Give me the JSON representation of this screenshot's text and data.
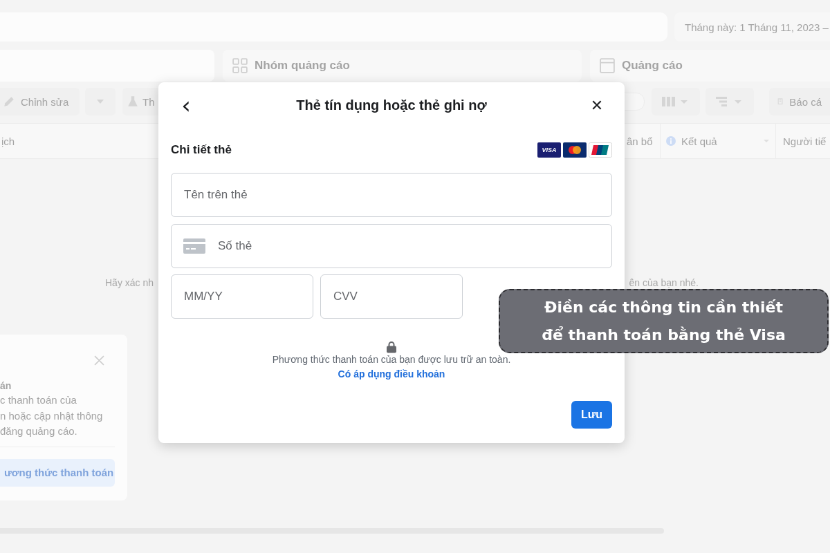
{
  "header": {
    "date_range": "Tháng này: 1 Tháng 11, 2023 –"
  },
  "level_tabs": [
    {
      "label": "Nhóm quảng cáo",
      "selected": false
    },
    {
      "label": "Quảng cáo",
      "selected": false
    }
  ],
  "toolbar": {
    "edit": "Chỉnh sửa",
    "test": "Th",
    "toggle": {
      "on": false
    },
    "reports": "Báo cá"
  },
  "table": {
    "columns": [
      "ịch",
      "ân bổ",
      "Kết quả",
      "Người tiế"
    ],
    "empty_message_parts": [
      "Hãy xác nh",
      "ên của bạn nhé."
    ]
  },
  "payment_card": {
    "title": "án",
    "body_lines": [
      "c thanh toán của",
      "n hoặc cập nhật thông",
      "đăng quảng cáo."
    ],
    "button": "ương thức thanh toán"
  },
  "dialog": {
    "back": "‹",
    "title": "Thẻ tín dụng hoặc thẻ ghi nợ",
    "close": "✕",
    "section": "Chi tiết thẻ",
    "card_brands": [
      {
        "kind": "visa",
        "label": "VISA"
      },
      {
        "kind": "mastercard"
      },
      {
        "kind": "unionpay"
      }
    ],
    "fields": [
      {
        "kind": "full",
        "placeholder": "Tên trên thẻ"
      },
      {
        "kind": "card",
        "placeholder": "Số thẻ"
      },
      {
        "kind": "half",
        "placeholder": "MM/YY"
      },
      {
        "kind": "half",
        "placeholder": "CVV"
      }
    ],
    "notice": "Phương thức thanh toán của bạn được lưu trữ an toàn.",
    "terms_link": "Có áp dụng điều khoản",
    "save": "Lưu"
  },
  "callout": {
    "lines": [
      "Điền các thông tin cần thiết",
      "để thanh toán bằng thẻ Visa"
    ]
  }
}
